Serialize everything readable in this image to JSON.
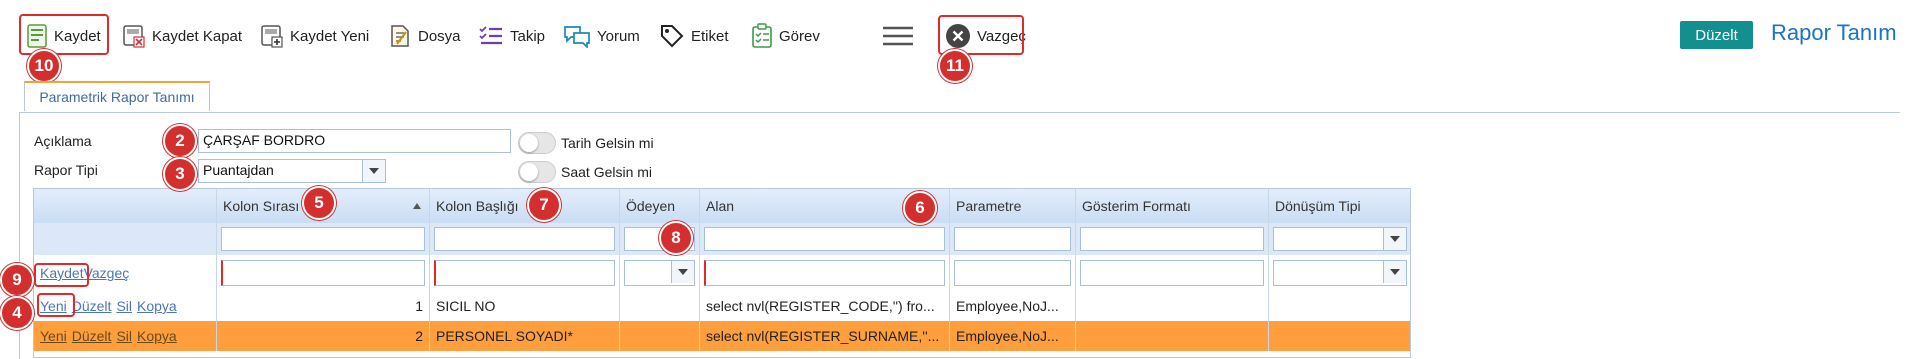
{
  "toolbar": {
    "kaydet": "Kaydet",
    "kaydet_kapat": "Kaydet Kapat",
    "kaydet_yeni": "Kaydet Yeni",
    "dosya": "Dosya",
    "takip": "Takip",
    "yorum": "Yorum",
    "etiket": "Etiket",
    "gorev": "Görev",
    "vazgec": "Vazgeç"
  },
  "header": {
    "duzelt_label": "Düzelt",
    "title": "Rapor Tanım"
  },
  "tab_label": "Parametrik Rapor Tanımı",
  "form": {
    "aciklama_label": "Açıklama",
    "aciklama_value": "ÇARŞAF BORDRO",
    "rapor_tipi_label": "Rapor Tipi",
    "rapor_tipi_value": "Puantajdan",
    "tarih_label": "Tarih Gelsin mi",
    "saat_label": "Saat Gelsin mi"
  },
  "grid": {
    "columns": [
      "Kolon Sırası",
      "Kolon Başlığı",
      "Ödeyen",
      "Alan",
      "Parametre",
      "Gösterim Formatı",
      "Dönüşüm Tipi"
    ],
    "edit_actions": [
      "Kaydet",
      "Vazgeç"
    ],
    "row_actions": [
      "Yeni",
      "Düzelt",
      "Sil",
      "Kopya"
    ],
    "rows": [
      {
        "sira": "1",
        "baslik": "SICIL NO",
        "odeyen": "",
        "alan": "select nvl(REGISTER_CODE,'') fro...",
        "parametre": "Employee,NoJ...",
        "format": "",
        "donusum": ""
      },
      {
        "sira": "2",
        "baslik": "PERSONEL SOYADI*",
        "odeyen": "",
        "alan": "select nvl(REGISTER_SURNAME,''...",
        "parametre": "Employee,NoJ...",
        "format": "",
        "donusum": ""
      }
    ]
  },
  "annotations": [
    "10",
    "11",
    "2",
    "3",
    "5",
    "7",
    "6",
    "8",
    "9",
    "4"
  ],
  "colors": {
    "accent": "#138f8f",
    "title": "#1b73c6",
    "highlight_row": "#ff9e3d",
    "marker": "#d32f2f"
  }
}
